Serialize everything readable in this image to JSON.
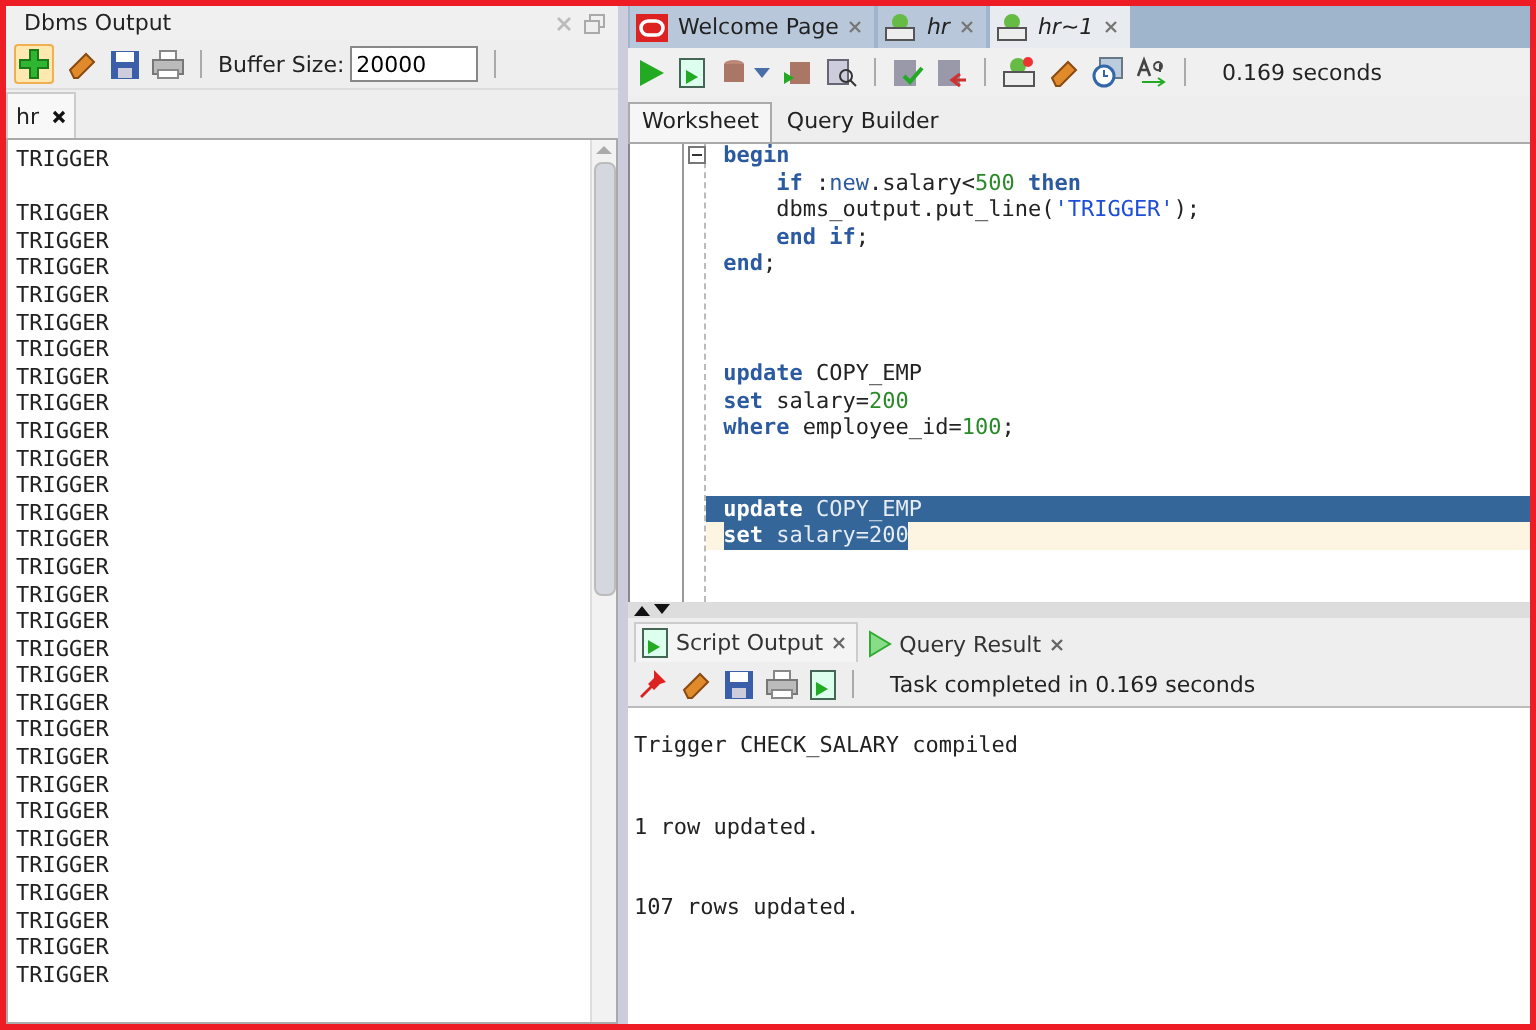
{
  "dbms_output": {
    "title": "Dbms Output",
    "buffer_label": "Buffer Size:",
    "buffer_value": "20000",
    "tabs": [
      {
        "label": "hr",
        "selected": true
      }
    ],
    "groups": [
      [
        "TRIGGER"
      ],
      [
        "TRIGGER",
        "TRIGGER",
        "TRIGGER",
        "TRIGGER",
        "TRIGGER",
        "TRIGGER",
        "TRIGGER",
        "TRIGGER",
        "TRIGGER",
        "TRIGGER",
        "TRIGGER",
        "TRIGGER",
        "TRIGGER",
        "TRIGGER",
        "TRIGGER",
        "TRIGGER",
        "TRIGGER",
        "TRIGGER",
        "TRIGGER",
        "TRIGGER",
        "TRIGGER",
        "TRIGGER",
        "TRIGGER",
        "TRIGGER",
        "TRIGGER",
        "TRIGGER",
        "TRIGGER",
        "TRIGGER",
        "TRIGGER"
      ]
    ]
  },
  "editor_tabs": [
    {
      "label": "Welcome Page",
      "kind": "welcome",
      "italic": false,
      "selected": false
    },
    {
      "label": "hr",
      "kind": "sql",
      "italic": true,
      "selected": false
    },
    {
      "label": "hr~1",
      "kind": "sql",
      "italic": true,
      "selected": true
    }
  ],
  "toolbar_status": "0.169 seconds",
  "worksheet_tabs": [
    {
      "label": "Worksheet",
      "selected": true
    },
    {
      "label": "Query Builder",
      "selected": false
    }
  ],
  "code_blocks": [
    {
      "lines": [
        {
          "selected": false,
          "current": false,
          "fold": true,
          "tokens": [
            {
              "kind": "keyword",
              "text": "begin"
            }
          ]
        },
        {
          "selected": false,
          "current": false,
          "fold": false,
          "tokens": [
            {
              "kind": "keyword",
              "text": "    if"
            },
            {
              "kind": "plain",
              "text": " :"
            },
            {
              "kind": "bind",
              "text": "new"
            },
            {
              "kind": "plain",
              "text": ".salary<"
            },
            {
              "kind": "number",
              "text": "500"
            },
            {
              "kind": "keyword",
              "text": " then"
            }
          ]
        },
        {
          "selected": false,
          "current": false,
          "fold": false,
          "tokens": [
            {
              "kind": "plain",
              "text": "    dbms_output.put_line("
            },
            {
              "kind": "string",
              "text": "'TRIGGER'"
            },
            {
              "kind": "plain",
              "text": ");"
            }
          ]
        },
        {
          "selected": false,
          "current": false,
          "fold": false,
          "tokens": [
            {
              "kind": "keyword",
              "text": "    end"
            },
            {
              "kind": "keyword",
              "text": " if"
            },
            {
              "kind": "plain",
              "text": ";"
            }
          ]
        },
        {
          "selected": false,
          "current": false,
          "fold": false,
          "tokens": [
            {
              "kind": "keyword",
              "text": "end"
            },
            {
              "kind": "plain",
              "text": ";"
            }
          ]
        }
      ]
    },
    {
      "lines": [
        {
          "selected": false,
          "current": false,
          "fold": false,
          "tokens": [
            {
              "kind": "keyword",
              "text": "update"
            },
            {
              "kind": "plain",
              "text": " COPY_EMP"
            }
          ]
        },
        {
          "selected": false,
          "current": false,
          "fold": false,
          "tokens": [
            {
              "kind": "keyword",
              "text": "set"
            },
            {
              "kind": "plain",
              "text": " salary="
            },
            {
              "kind": "number",
              "text": "200"
            }
          ]
        },
        {
          "selected": false,
          "current": false,
          "fold": false,
          "tokens": [
            {
              "kind": "keyword",
              "text": "where"
            },
            {
              "kind": "plain",
              "text": " employee_id="
            },
            {
              "kind": "number",
              "text": "100"
            },
            {
              "kind": "plain",
              "text": ";"
            }
          ]
        }
      ]
    },
    {
      "lines": [
        {
          "selected": true,
          "current": false,
          "fold": false,
          "tokens": [
            {
              "kind": "keyword",
              "text": "update"
            },
            {
              "kind": "plain",
              "text": " COPY_EMP"
            }
          ]
        },
        {
          "selected": true,
          "current": true,
          "fold": false,
          "tokens": [
            {
              "kind": "keyword",
              "text": "set"
            },
            {
              "kind": "plain",
              "text": " salary="
            },
            {
              "kind": "number",
              "text": "200"
            }
          ]
        }
      ]
    }
  ],
  "output_tabs": [
    {
      "label": "Script Output",
      "kind": "script",
      "selected": true
    },
    {
      "label": "Query Result",
      "kind": "query",
      "selected": false
    }
  ],
  "output_status": "Task completed in 0.169 seconds",
  "output_lines": [
    "Trigger CHECK_SALARY compiled",
    "1 row updated.",
    "107 rows updated."
  ]
}
